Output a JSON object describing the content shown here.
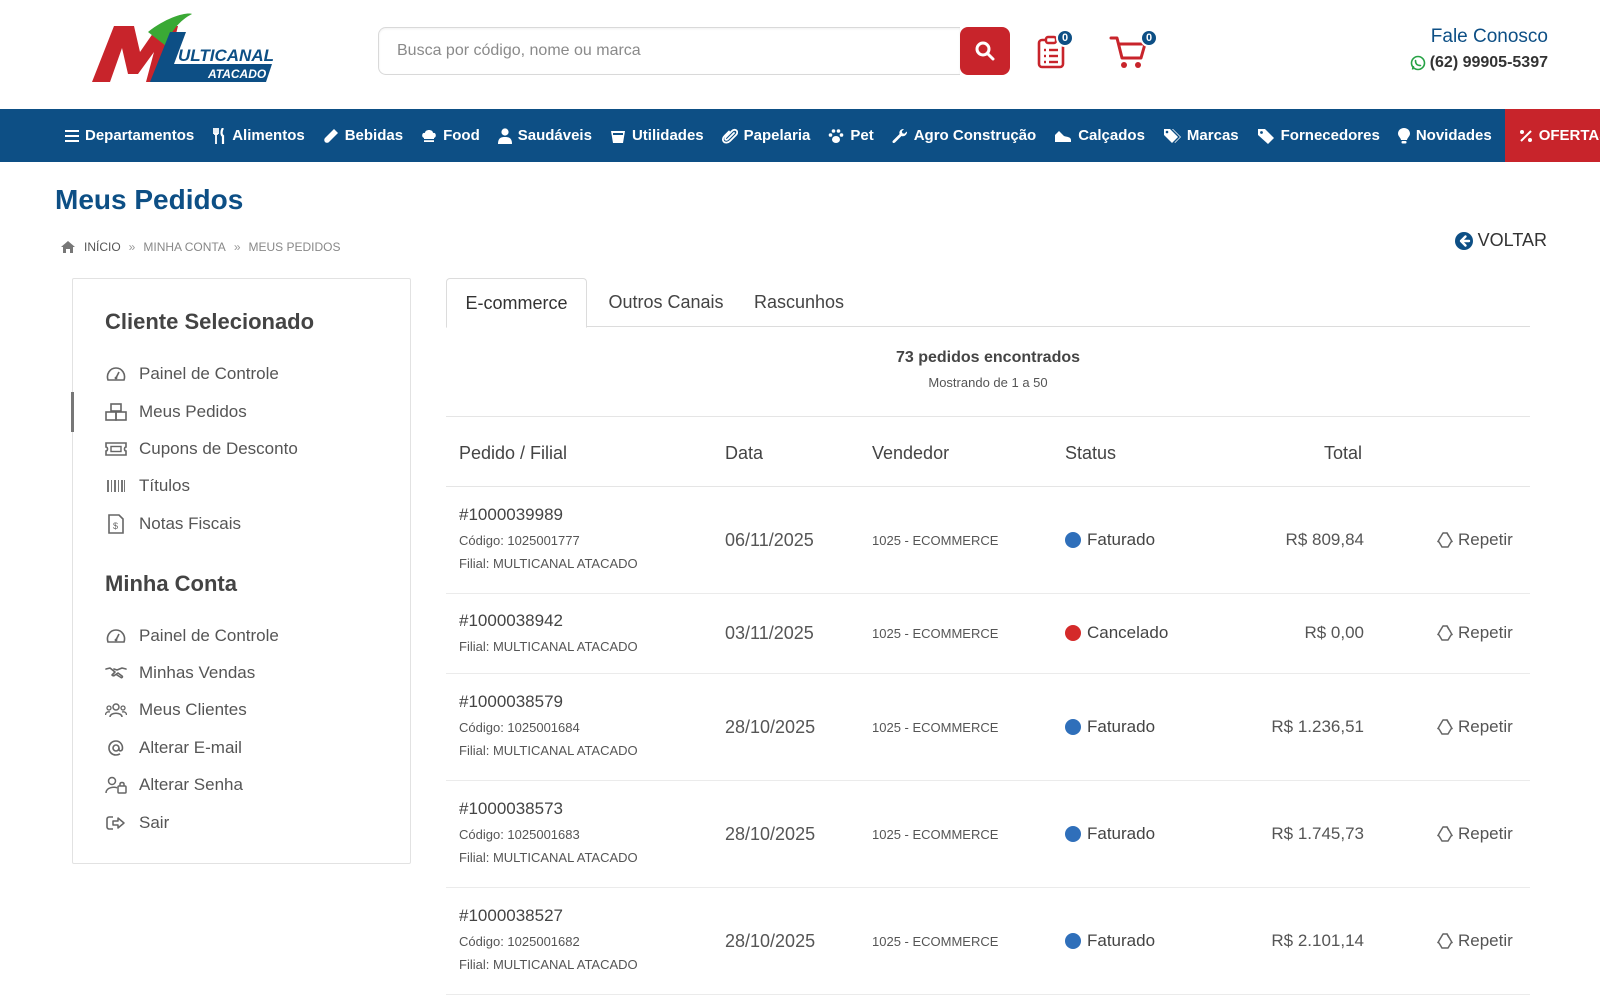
{
  "header": {
    "logo": {
      "brand_text": "ULTICANAL",
      "sub_text": "ATACADO",
      "colors": {
        "red": "#c8242b",
        "blue": "#0d4f85",
        "green": "#3aa935"
      }
    },
    "search": {
      "placeholder": "Busca por código, nome ou marca",
      "value": ""
    },
    "list_badge": "0",
    "cart_badge": "0",
    "contact_label": "Fale Conosco",
    "phone": "(62) 99905-5397"
  },
  "nav": {
    "items": [
      {
        "label": "Departamentos",
        "icon": "menu-icon"
      },
      {
        "label": "Alimentos",
        "icon": "utensils-icon"
      },
      {
        "label": "Bebidas",
        "icon": "bottle-icon"
      },
      {
        "label": "Food",
        "icon": "chef-hat-icon"
      },
      {
        "label": "Saudáveis",
        "icon": "person-icon"
      },
      {
        "label": "Utilidades",
        "icon": "bucket-icon"
      },
      {
        "label": "Papelaria",
        "icon": "paperclip-icon"
      },
      {
        "label": "Pet",
        "icon": "paw-icon"
      },
      {
        "label": "Agro Construção",
        "icon": "wrench-icon"
      },
      {
        "label": "Calçados",
        "icon": "shoe-icon"
      },
      {
        "label": "Marcas",
        "icon": "tags-icon"
      },
      {
        "label": "Fornecedores",
        "icon": "tag-icon"
      },
      {
        "label": "Novidades",
        "icon": "lightbulb-icon"
      }
    ],
    "offers_label": "OFERTAS",
    "colors": {
      "bar": "#0d4f85",
      "offers": "#c8242b"
    }
  },
  "page": {
    "title": "Meus Pedidos",
    "breadcrumb": [
      "INÍCIO",
      "MINHA CONTA",
      "MEUS PEDIDOS"
    ],
    "back_label": "VOLTAR"
  },
  "sidebar": {
    "client_heading": "Cliente Selecionado",
    "client_items": [
      {
        "label": "Painel de Controle",
        "icon": "dashboard-icon"
      },
      {
        "label": "Meus Pedidos",
        "icon": "boxes-icon",
        "active": true
      },
      {
        "label": "Cupons de Desconto",
        "icon": "coupon-icon"
      },
      {
        "label": "Títulos",
        "icon": "barcode-icon"
      },
      {
        "label": "Notas Fiscais",
        "icon": "invoice-icon"
      }
    ],
    "account_heading": "Minha Conta",
    "account_items": [
      {
        "label": "Painel de Controle",
        "icon": "dashboard-icon"
      },
      {
        "label": "Minhas Vendas",
        "icon": "handshake-icon"
      },
      {
        "label": "Meus Clientes",
        "icon": "users-icon"
      },
      {
        "label": "Alterar E-mail",
        "icon": "at-icon"
      },
      {
        "label": "Alterar Senha",
        "icon": "user-lock-icon"
      },
      {
        "label": "Sair",
        "icon": "logout-icon"
      }
    ]
  },
  "tabs": [
    "E-commerce",
    "Outros Canais",
    "Rascunhos"
  ],
  "summary": {
    "count": "73 pedidos encontrados",
    "range": "Mostrando de 1 a 50"
  },
  "table": {
    "headers": {
      "order": "Pedido / Filial",
      "date": "Data",
      "seller": "Vendedor",
      "status": "Status",
      "total": "Total"
    },
    "repeat_label": "Repetir",
    "status_colors": {
      "Faturado": "#2f6fba",
      "Cancelado": "#d42a2a"
    },
    "rows": [
      {
        "order": "#1000039989",
        "code": "Código: 1025001777",
        "branch": "Filial: MULTICANAL ATACADO",
        "date": "06/11/2025",
        "seller": "1025 - ECOMMERCE",
        "status": "Faturado",
        "total": "R$ 809,84"
      },
      {
        "order": "#1000038942",
        "code": "",
        "branch": "Filial: MULTICANAL ATACADO",
        "date": "03/11/2025",
        "seller": "1025 - ECOMMERCE",
        "status": "Cancelado",
        "total": "R$ 0,00"
      },
      {
        "order": "#1000038579",
        "code": "Código: 1025001684",
        "branch": "Filial: MULTICANAL ATACADO",
        "date": "28/10/2025",
        "seller": "1025 - ECOMMERCE",
        "status": "Faturado",
        "total": "R$ 1.236,51"
      },
      {
        "order": "#1000038573",
        "code": "Código: 1025001683",
        "branch": "Filial: MULTICANAL ATACADO",
        "date": "28/10/2025",
        "seller": "1025 - ECOMMERCE",
        "status": "Faturado",
        "total": "R$ 1.745,73"
      },
      {
        "order": "#1000038527",
        "code": "Código: 1025001682",
        "branch": "Filial: MULTICANAL ATACADO",
        "date": "28/10/2025",
        "seller": "1025 - ECOMMERCE",
        "status": "Faturado",
        "total": "R$ 2.101,14"
      }
    ]
  }
}
